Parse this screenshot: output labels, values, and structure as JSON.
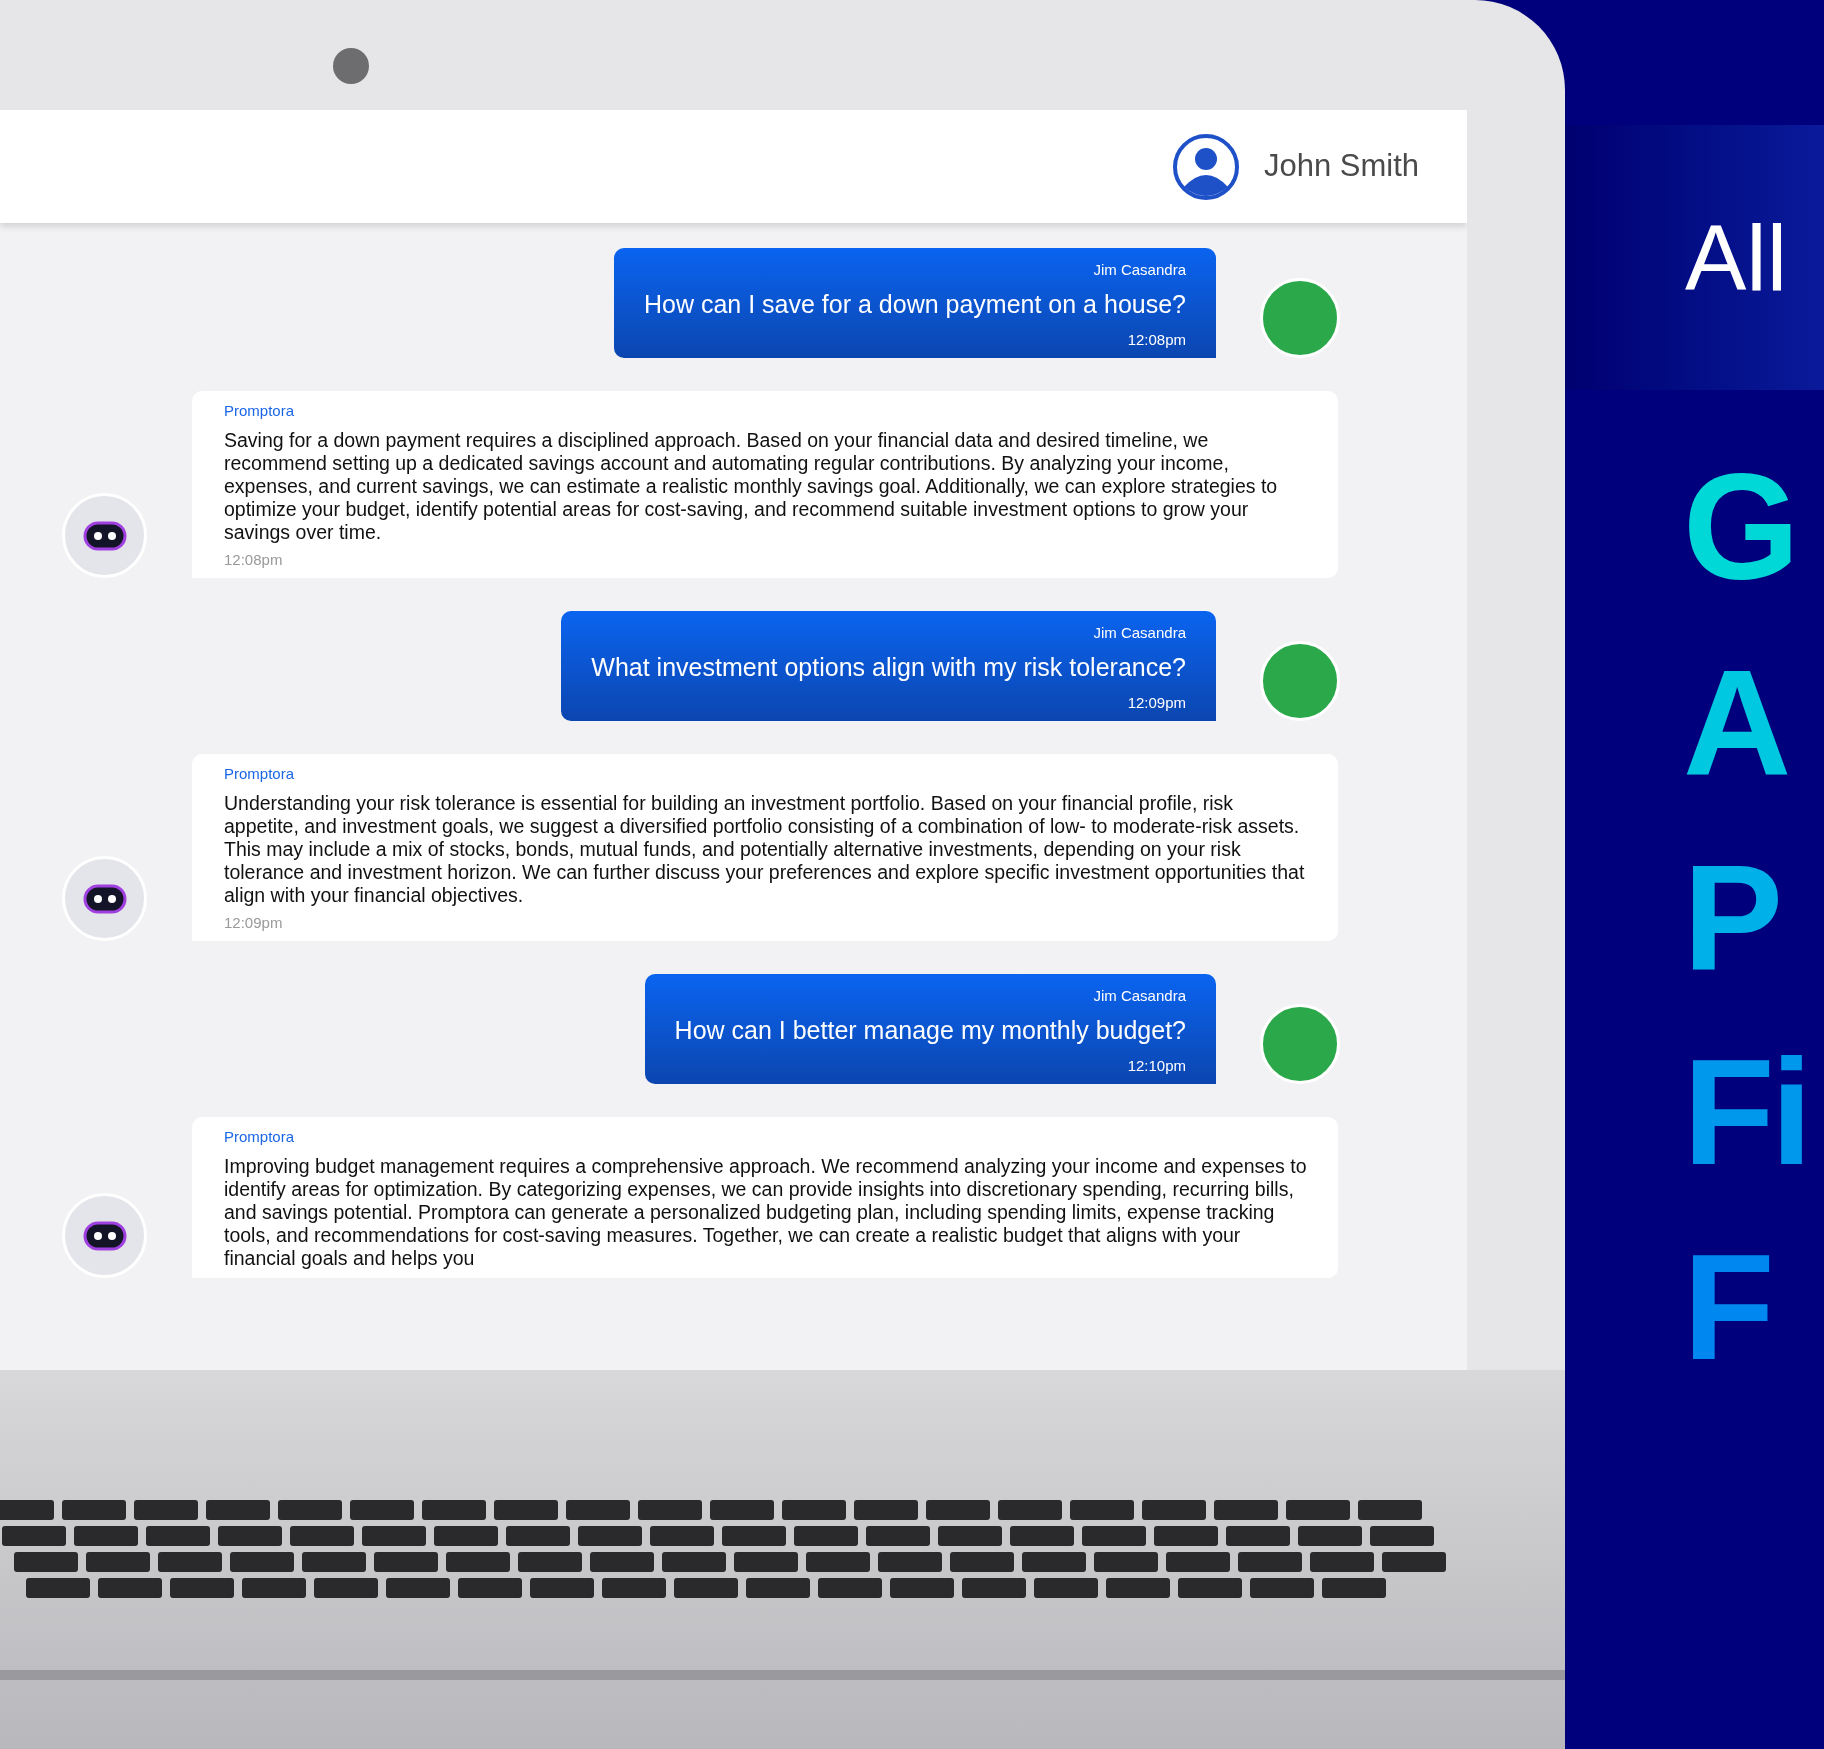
{
  "header": {
    "user_name": "John Smith"
  },
  "messages": [
    {
      "kind": "user",
      "sender": "Jim Casandra",
      "text": "How can I save for a down payment on a house?",
      "time": "12:08pm"
    },
    {
      "kind": "bot",
      "sender": "Promptora",
      "text": "Saving for a down payment requires a disciplined approach. Based on your financial data and desired timeline, we recommend setting up a dedicated savings account and automating regular contributions. By analyzing your income, expenses, and current savings, we can estimate a realistic monthly savings goal. Additionally, we can explore strategies to optimize your budget, identify potential areas for cost-saving, and recommend suitable investment options to grow your savings over time.",
      "time": "12:08pm"
    },
    {
      "kind": "user",
      "sender": "Jim Casandra",
      "text": "What investment options align with my risk tolerance?",
      "time": "12:09pm"
    },
    {
      "kind": "bot",
      "sender": "Promptora",
      "text": "Understanding your risk tolerance is essential for building an investment portfolio. Based on your financial profile, risk appetite, and investment goals, we suggest a diversified portfolio consisting of a combination of low- to moderate-risk assets. This may include a mix of stocks, bonds, mutual funds, and potentially alternative investments, depending on your risk tolerance and investment horizon. We can further discuss your preferences and explore specific investment opportunities that align with your financial objectives.",
      "time": "12:09pm"
    },
    {
      "kind": "user",
      "sender": "Jim Casandra",
      "text": "How can I better manage my monthly budget?",
      "time": "12:10pm"
    },
    {
      "kind": "bot",
      "sender": "Promptora",
      "text": "Improving budget management requires a comprehensive approach. We recommend analyzing your income and expenses to identify areas for optimization. By categorizing expenses, we can provide insights into discretionary spending, recurring bills, and savings potential. Promptora can generate a personalized budgeting plan, including spending limits, expense tracking tools, and recommendations for cost-saving measures. Together, we can create a realistic budget that aligns with your financial goals and helps you"
    }
  ],
  "side": {
    "tagline": "All",
    "headline_lines": [
      "G",
      "A",
      "P",
      "Fi",
      "F"
    ]
  }
}
